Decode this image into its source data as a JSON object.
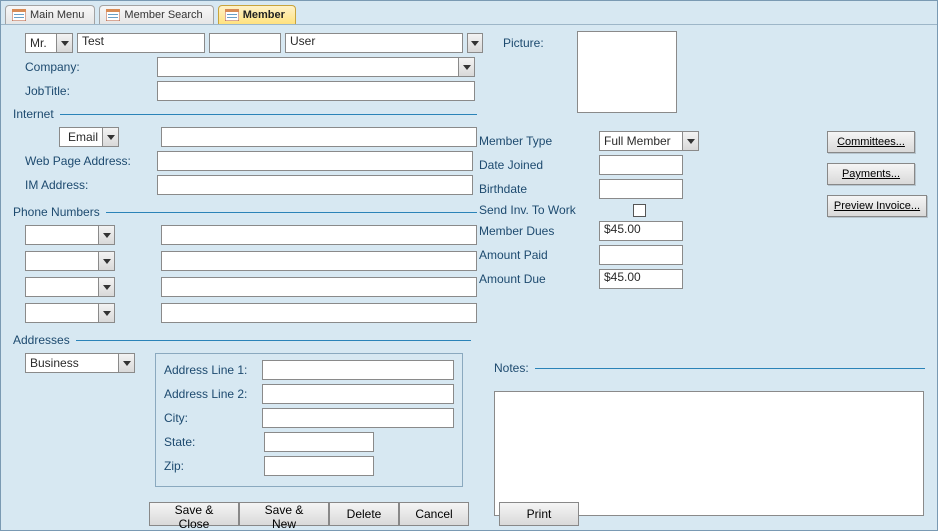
{
  "tabs": {
    "main_menu": "Main Menu",
    "member_search": "Member Search",
    "member": "Member"
  },
  "name_row": {
    "title": "Mr.",
    "first": "Test",
    "middle": "",
    "last": "User"
  },
  "labels": {
    "company": "Company:",
    "job_title": "JobTitle:",
    "picture": "Picture:",
    "internet": "Internet",
    "email": "Email",
    "web_page": "Web Page Address:",
    "im": "IM Address:",
    "phone_numbers": "Phone Numbers",
    "addresses": "Addresses",
    "address_type": "Business",
    "addr_line1": "Address Line 1:",
    "addr_line2": "Address Line 2:",
    "city": "City:",
    "state": "State:",
    "zip": "Zip:",
    "notes": "Notes:",
    "member_type": "Member Type",
    "date_joined": "Date Joined",
    "birthdate": "Birthdate",
    "send_inv": "Send Inv. To Work",
    "member_dues": "Member Dues",
    "amount_paid": "Amount Paid",
    "amount_due": "Amount Due"
  },
  "member_info": {
    "member_type": "Full Member",
    "date_joined": "",
    "birthdate": "",
    "send_inv_to_work": false,
    "member_dues": "$45.00",
    "amount_paid": "",
    "amount_due": "$45.00"
  },
  "side_buttons": {
    "committees": "Committees...",
    "payments": "Payments...",
    "preview": "Preview Invoice..."
  },
  "bottom_buttons": {
    "save_close": "Save & Close",
    "save_new": "Save & New",
    "delete": "Delete",
    "cancel": "Cancel",
    "print": "Print"
  },
  "fields": {
    "company": "",
    "job_title": "",
    "email": "",
    "web_page": "",
    "im": "",
    "addr1": "",
    "addr2": "",
    "city": "",
    "state": "",
    "zip": "",
    "notes": ""
  }
}
